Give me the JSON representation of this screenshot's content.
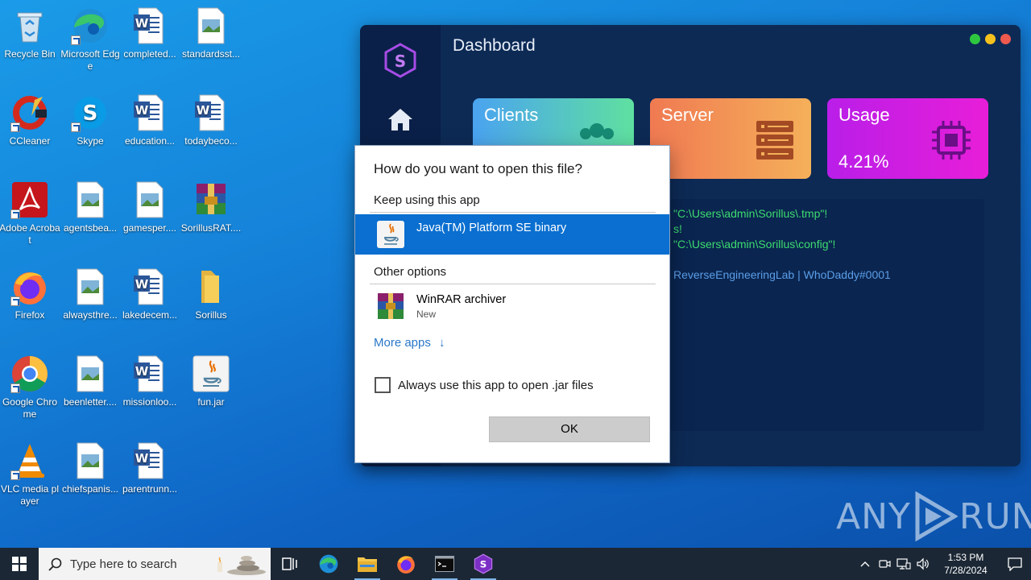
{
  "desktop": {
    "icons": [
      {
        "label": "Recycle Bin"
      },
      {
        "label": "Microsoft Edge"
      },
      {
        "label": "completed..."
      },
      {
        "label": "standardsst..."
      },
      {
        "label": "CCleaner"
      },
      {
        "label": "Skype"
      },
      {
        "label": "education..."
      },
      {
        "label": "todaybeco..."
      },
      {
        "label": "Adobe Acrobat"
      },
      {
        "label": "agentsbea..."
      },
      {
        "label": "gamesper...."
      },
      {
        "label": "SorillusRAT...."
      },
      {
        "label": "Firefox"
      },
      {
        "label": "alwaysthre..."
      },
      {
        "label": "lakedecem..."
      },
      {
        "label": "Sorillus"
      },
      {
        "label": "Google Chrome"
      },
      {
        "label": "beenletter...."
      },
      {
        "label": "missionloo..."
      },
      {
        "label": "fun.jar"
      },
      {
        "label": "VLC media player"
      },
      {
        "label": "chiefspanis..."
      },
      {
        "label": "parentrunn..."
      }
    ]
  },
  "app": {
    "title": "Dashboard",
    "cards": [
      {
        "title": "Clients",
        "value": "",
        "icon": "users-icon"
      },
      {
        "title": "Server",
        "value": "",
        "icon": "server-icon"
      },
      {
        "title": "Usage",
        "value": "4.21%",
        "icon": "cpu-icon"
      }
    ],
    "console_lines": [
      "\"C:\\Users\\admin\\Sorillus\\.tmp\"!",
      "s!",
      "\"C:\\Users\\admin\\Sorillus\\config\"!",
      "ReverseEngineeringLab | WhoDaddy#0001"
    ],
    "colors": {
      "console_green": "#3ddc6f",
      "console_blue": "#5b9ee8"
    }
  },
  "dialog": {
    "question": "How do you want to open this file?",
    "keep_using": "Keep using this app",
    "current_app": "Java(TM) Platform SE binary",
    "other_options": "Other options",
    "other_app_name": "WinRAR archiver",
    "other_app_sub": "New",
    "more_apps": "More apps",
    "more_apps_arrow": "↓",
    "always_use": "Always use this app to open .jar files",
    "ok": "OK"
  },
  "watermark": {
    "left": "ANY",
    "right": "RUN"
  },
  "taskbar": {
    "search_placeholder": "Type here to search",
    "time": "1:53 PM",
    "date": "7/28/2024"
  }
}
